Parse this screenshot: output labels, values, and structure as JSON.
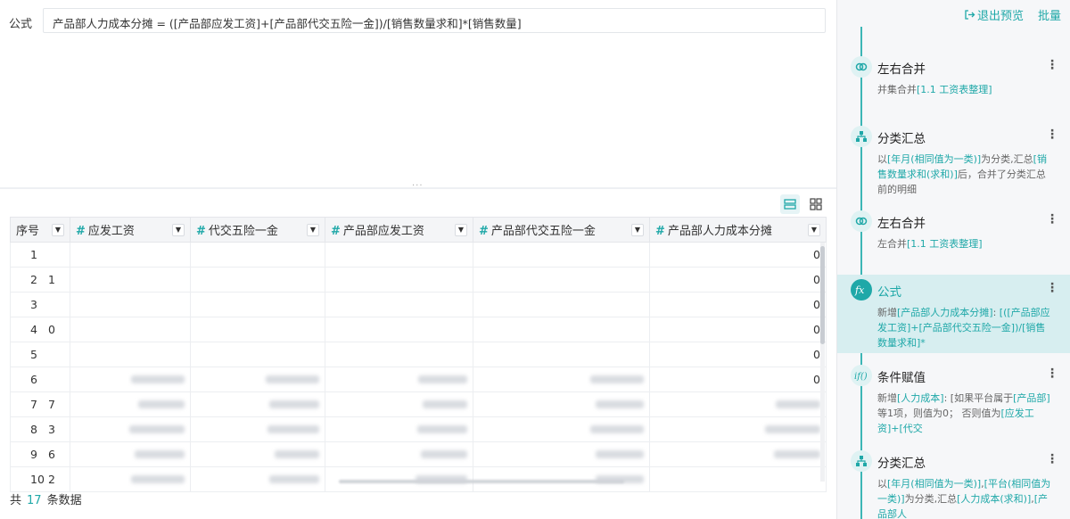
{
  "formula": {
    "label": "公式",
    "expression": "产品部人力成本分摊 = ([产品部应发工资]+[产品部代交五险一金])/[销售数量求和]*[销售数量]"
  },
  "splitter_dots": "...",
  "table": {
    "columns": [
      {
        "label": "序号",
        "type": "text"
      },
      {
        "label": "应发工资",
        "type": "number"
      },
      {
        "label": "代交五险一金",
        "type": "number"
      },
      {
        "label": "产品部应发工资",
        "type": "number"
      },
      {
        "label": "产品部代交五险一金",
        "type": "number"
      },
      {
        "label": "产品部人力成本分摊",
        "type": "number"
      }
    ],
    "rows": [
      {
        "index": "1",
        "sub": "",
        "last": "0"
      },
      {
        "index": "2",
        "sub": "1",
        "last": "0"
      },
      {
        "index": "3",
        "sub": "",
        "last": "0"
      },
      {
        "index": "4",
        "sub": "0",
        "last": "0"
      },
      {
        "index": "5",
        "sub": "",
        "last": "0"
      },
      {
        "index": "6",
        "sub": "",
        "last": "0"
      },
      {
        "index": "7",
        "sub": "7",
        "last": ""
      },
      {
        "index": "8",
        "sub": "3",
        "last": ""
      },
      {
        "index": "9",
        "sub": "6",
        "last": ""
      },
      {
        "index": "10",
        "sub": "2",
        "last": ""
      }
    ]
  },
  "footer": {
    "prefix": "共",
    "count": "17",
    "suffix": "条数据"
  },
  "right_panel": {
    "exit_preview": "退出预览",
    "batch": "批量",
    "steps": [
      {
        "icon": "merge-icon",
        "title": "左右合并",
        "desc_parts": [
          [
            "并集合并",
            ""
          ],
          [
            "[1.1 工资表整理]",
            "hl"
          ]
        ]
      },
      {
        "icon": "group-summary-icon",
        "title": "分类汇总",
        "desc_parts": [
          [
            "以",
            ""
          ],
          [
            "[年月(相同值为一类)]",
            "hl"
          ],
          [
            "为分类,汇总",
            ""
          ],
          [
            "[销售数量求和(求和)]",
            "hl"
          ],
          [
            "后，合并了分类汇总前的明细",
            ""
          ]
        ]
      },
      {
        "icon": "merge-icon",
        "title": "左右合并",
        "desc_parts": [
          [
            "左合并",
            ""
          ],
          [
            "[1.1 工资表整理]",
            "hl"
          ]
        ]
      },
      {
        "icon": "formula-icon",
        "title": "公式",
        "desc_parts": [
          [
            "新增",
            ""
          ],
          [
            "[产品部人力成本分摊]",
            "hl"
          ],
          [
            ": ",
            ""
          ],
          [
            "[([产品部应发工资]+[产品部代交五险一金])/[销售数量求和]*",
            "hl"
          ]
        ]
      },
      {
        "icon": "conditional-assign-icon",
        "title": "条件赋值",
        "desc_parts": [
          [
            "新增",
            ""
          ],
          [
            "[人力成本]",
            "hl"
          ],
          [
            ": [如果平台属于",
            ""
          ],
          [
            "[产品部]",
            "hl"
          ],
          [
            "等1项，则值为0； 否则值为",
            ""
          ],
          [
            "[应发工资]+[代交",
            "hl"
          ]
        ]
      },
      {
        "icon": "group-summary-icon",
        "title": "分类汇总",
        "desc_parts": [
          [
            "以",
            ""
          ],
          [
            "[年月(相同值为一类)]",
            "hl"
          ],
          [
            ",",
            ""
          ],
          [
            "[平台(相同值为一类)]",
            "hl"
          ],
          [
            "为分类,汇总",
            ""
          ],
          [
            "[人力成本(求和)]",
            "hl"
          ],
          [
            ",",
            ""
          ],
          [
            "[产品部人",
            "hl"
          ]
        ]
      }
    ]
  }
}
